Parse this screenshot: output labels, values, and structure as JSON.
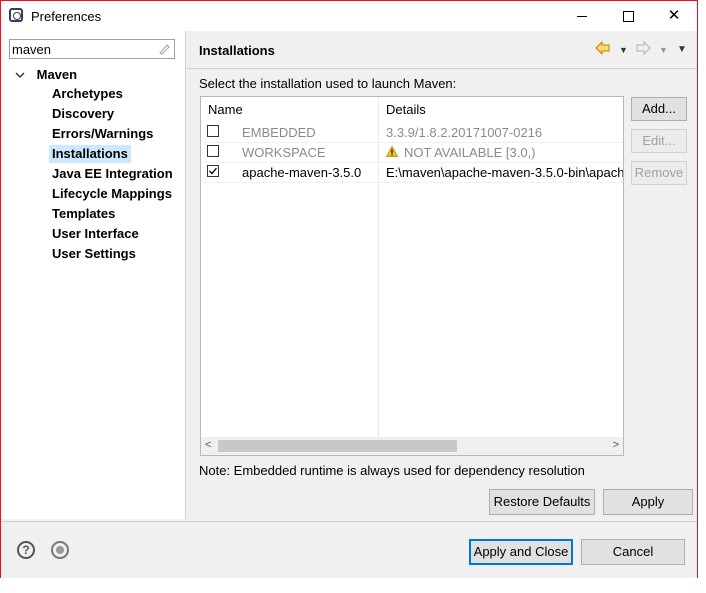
{
  "window": {
    "title": "Preferences",
    "minimize_icon": "minimize-icon",
    "maximize_icon": "maximize-icon",
    "close_symbol": "✕"
  },
  "sidebar": {
    "filter_value": "maven",
    "tree_root": "Maven",
    "items": [
      {
        "label": "Archetypes"
      },
      {
        "label": "Discovery"
      },
      {
        "label": "Errors/Warnings"
      },
      {
        "label": "Installations",
        "selected": true
      },
      {
        "label": "Java EE Integration"
      },
      {
        "label": "Lifecycle Mappings"
      },
      {
        "label": "Templates"
      },
      {
        "label": "User Interface"
      },
      {
        "label": "User Settings"
      }
    ]
  },
  "page": {
    "title": "Installations",
    "instruction": "Select the installation used to launch Maven:",
    "table": {
      "columns": [
        "Name",
        "Details"
      ],
      "rows": [
        {
          "checked": false,
          "name": "EMBEDDED",
          "details": "3.3.9/1.8.2.20171007-0216",
          "enabled": false
        },
        {
          "checked": false,
          "name": "WORKSPACE",
          "details": "NOT AVAILABLE [3.0,)",
          "enabled": false,
          "warning": true
        },
        {
          "checked": true,
          "name": "apache-maven-3.5.0",
          "details": "E:\\maven\\apache-maven-3.5.0-bin\\apach",
          "enabled": true
        }
      ]
    },
    "buttons": {
      "add": "Add...",
      "edit": "Edit...",
      "remove": "Remove"
    },
    "note": "Note: Embedded runtime is always used for dependency resolution",
    "restore_defaults": "Restore Defaults",
    "apply": "Apply"
  },
  "footer": {
    "apply_and_close": "Apply and Close",
    "cancel": "Cancel",
    "help_symbol": "?"
  },
  "colors": {
    "selection": "#cce8ff",
    "accent": "#0078d7",
    "window_border": "#e81123"
  }
}
